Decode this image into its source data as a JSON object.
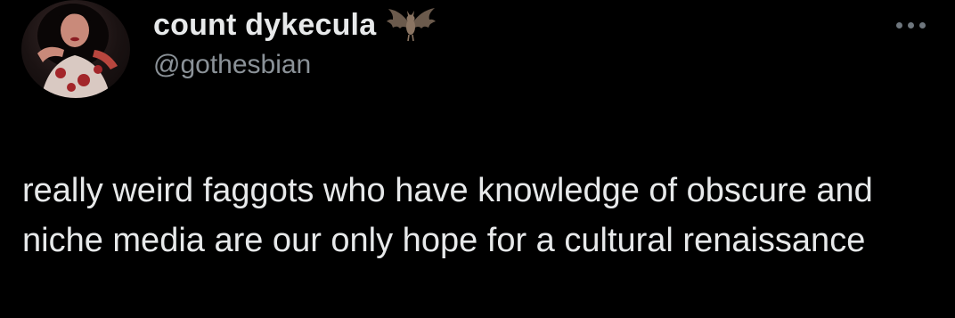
{
  "tweet": {
    "author": {
      "display_name": "count dykecula",
      "handle": "@gothesbian",
      "name_emoji_icon": "bat-icon",
      "avatar_icon": "profile-photo"
    },
    "more_icon": "ellipsis-icon",
    "text": "really weird faggots who have knowledge of obscure and niche media are our only hope for a cultural renaissance"
  },
  "colors": {
    "background": "#000000",
    "text_primary": "#e7e9ea",
    "text_secondary": "#8b9298",
    "icon_muted": "#6e767d"
  }
}
